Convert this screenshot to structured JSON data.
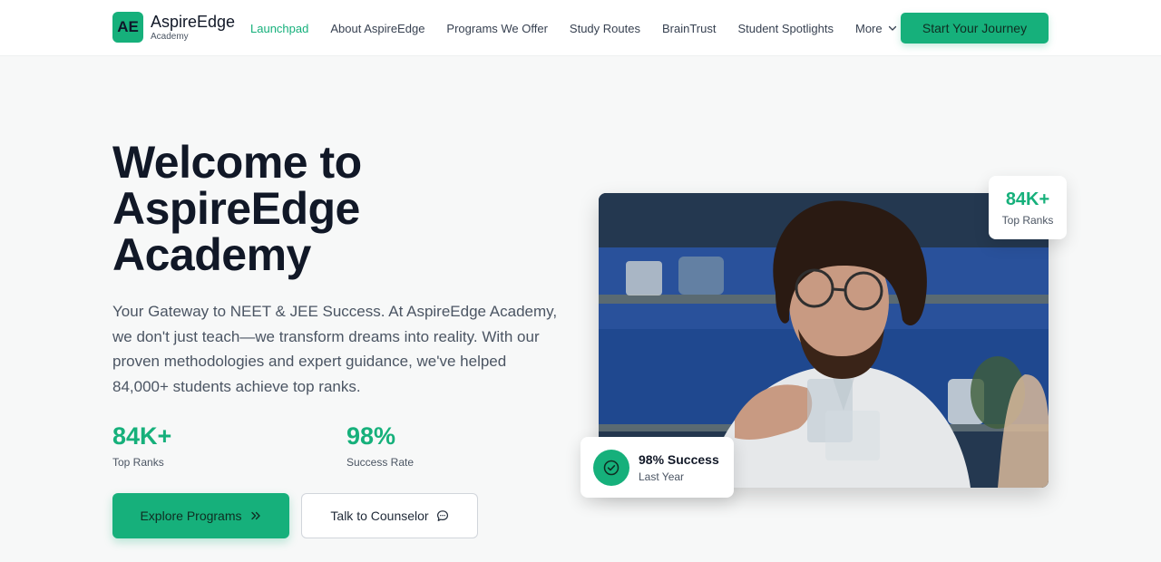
{
  "brand": {
    "badge": "AE",
    "name": "AspireEdge",
    "subtitle": "Academy"
  },
  "nav": {
    "links": [
      {
        "label": "Launchpad",
        "active": true
      },
      {
        "label": "About AspireEdge",
        "active": false
      },
      {
        "label": "Programs We Offer",
        "active": false
      },
      {
        "label": "Study Routes",
        "active": false
      },
      {
        "label": "BrainTrust",
        "active": false
      },
      {
        "label": "Student Spotlights",
        "active": false
      }
    ],
    "more_label": "More",
    "cta_label": "Start Your Journey"
  },
  "hero": {
    "title_line1": "Welcome to",
    "title_line2": "AspireEdge",
    "title_line3": "Academy",
    "description": "Your Gateway to NEET & JEE Success. At AspireEdge Academy, we don't just teach—we transform dreams into reality. With our proven methodologies and expert guidance, we've helped 84,000+ students achieve top ranks.",
    "stats": [
      {
        "value": "84K+",
        "label": "Top Ranks"
      },
      {
        "value": "98%",
        "label": "Success Rate"
      }
    ],
    "primary_button": "Explore Programs",
    "secondary_button": "Talk to Counselor"
  },
  "floating": {
    "top_badge": {
      "value": "84K+",
      "label": "Top Ranks"
    },
    "bottom_badge": {
      "title": "98% Success",
      "subtitle": "Last Year"
    }
  },
  "colors": {
    "accent": "#16b07b",
    "heading": "#111827",
    "body_text": "#4b5563"
  },
  "icons": {
    "more": "chevron-down-icon",
    "primary_button": "double-chevron-right-icon",
    "secondary_button": "chat-bubble-icon",
    "bottom_badge": "check-circle-icon"
  }
}
